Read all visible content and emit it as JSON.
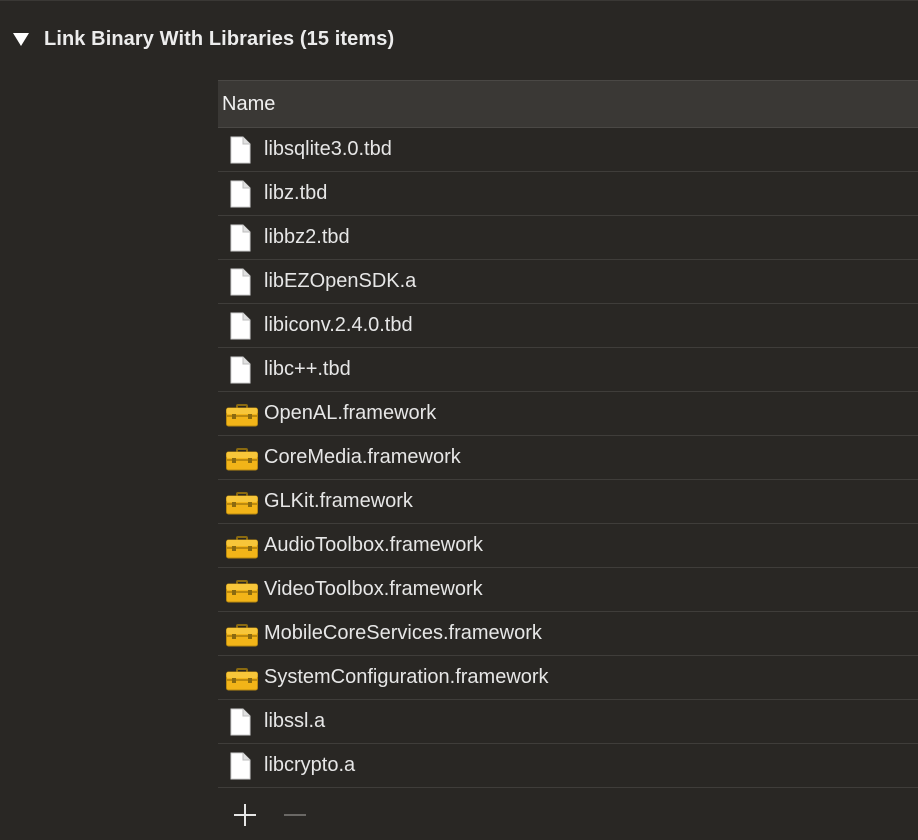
{
  "section": {
    "title": "Link Binary With Libraries (15 items)"
  },
  "table": {
    "column_header": "Name",
    "rows": [
      {
        "label": "libsqlite3.0.tbd",
        "icon": "file-icon"
      },
      {
        "label": "libz.tbd",
        "icon": "file-icon"
      },
      {
        "label": "libbz2.tbd",
        "icon": "file-icon"
      },
      {
        "label": "libEZOpenSDK.a",
        "icon": "file-icon"
      },
      {
        "label": "libiconv.2.4.0.tbd",
        "icon": "file-icon"
      },
      {
        "label": "libc++.tbd",
        "icon": "file-icon"
      },
      {
        "label": "OpenAL.framework",
        "icon": "toolbox-icon"
      },
      {
        "label": "CoreMedia.framework",
        "icon": "toolbox-icon"
      },
      {
        "label": "GLKit.framework",
        "icon": "toolbox-icon"
      },
      {
        "label": "AudioToolbox.framework",
        "icon": "toolbox-icon"
      },
      {
        "label": "VideoToolbox.framework",
        "icon": "toolbox-icon"
      },
      {
        "label": "MobileCoreServices.framework",
        "icon": "toolbox-icon"
      },
      {
        "label": "SystemConfiguration.framework",
        "icon": "toolbox-icon"
      },
      {
        "label": "libssl.a",
        "icon": "file-icon"
      },
      {
        "label": "libcrypto.a",
        "icon": "file-icon"
      }
    ]
  },
  "footer": {
    "add_icon": "plus-icon",
    "remove_icon": "minus-icon"
  },
  "colors": {
    "background": "#292724",
    "header_background": "#3a3835",
    "text": "#e6e6e6",
    "toolbox_yellow": "#f2b418"
  }
}
